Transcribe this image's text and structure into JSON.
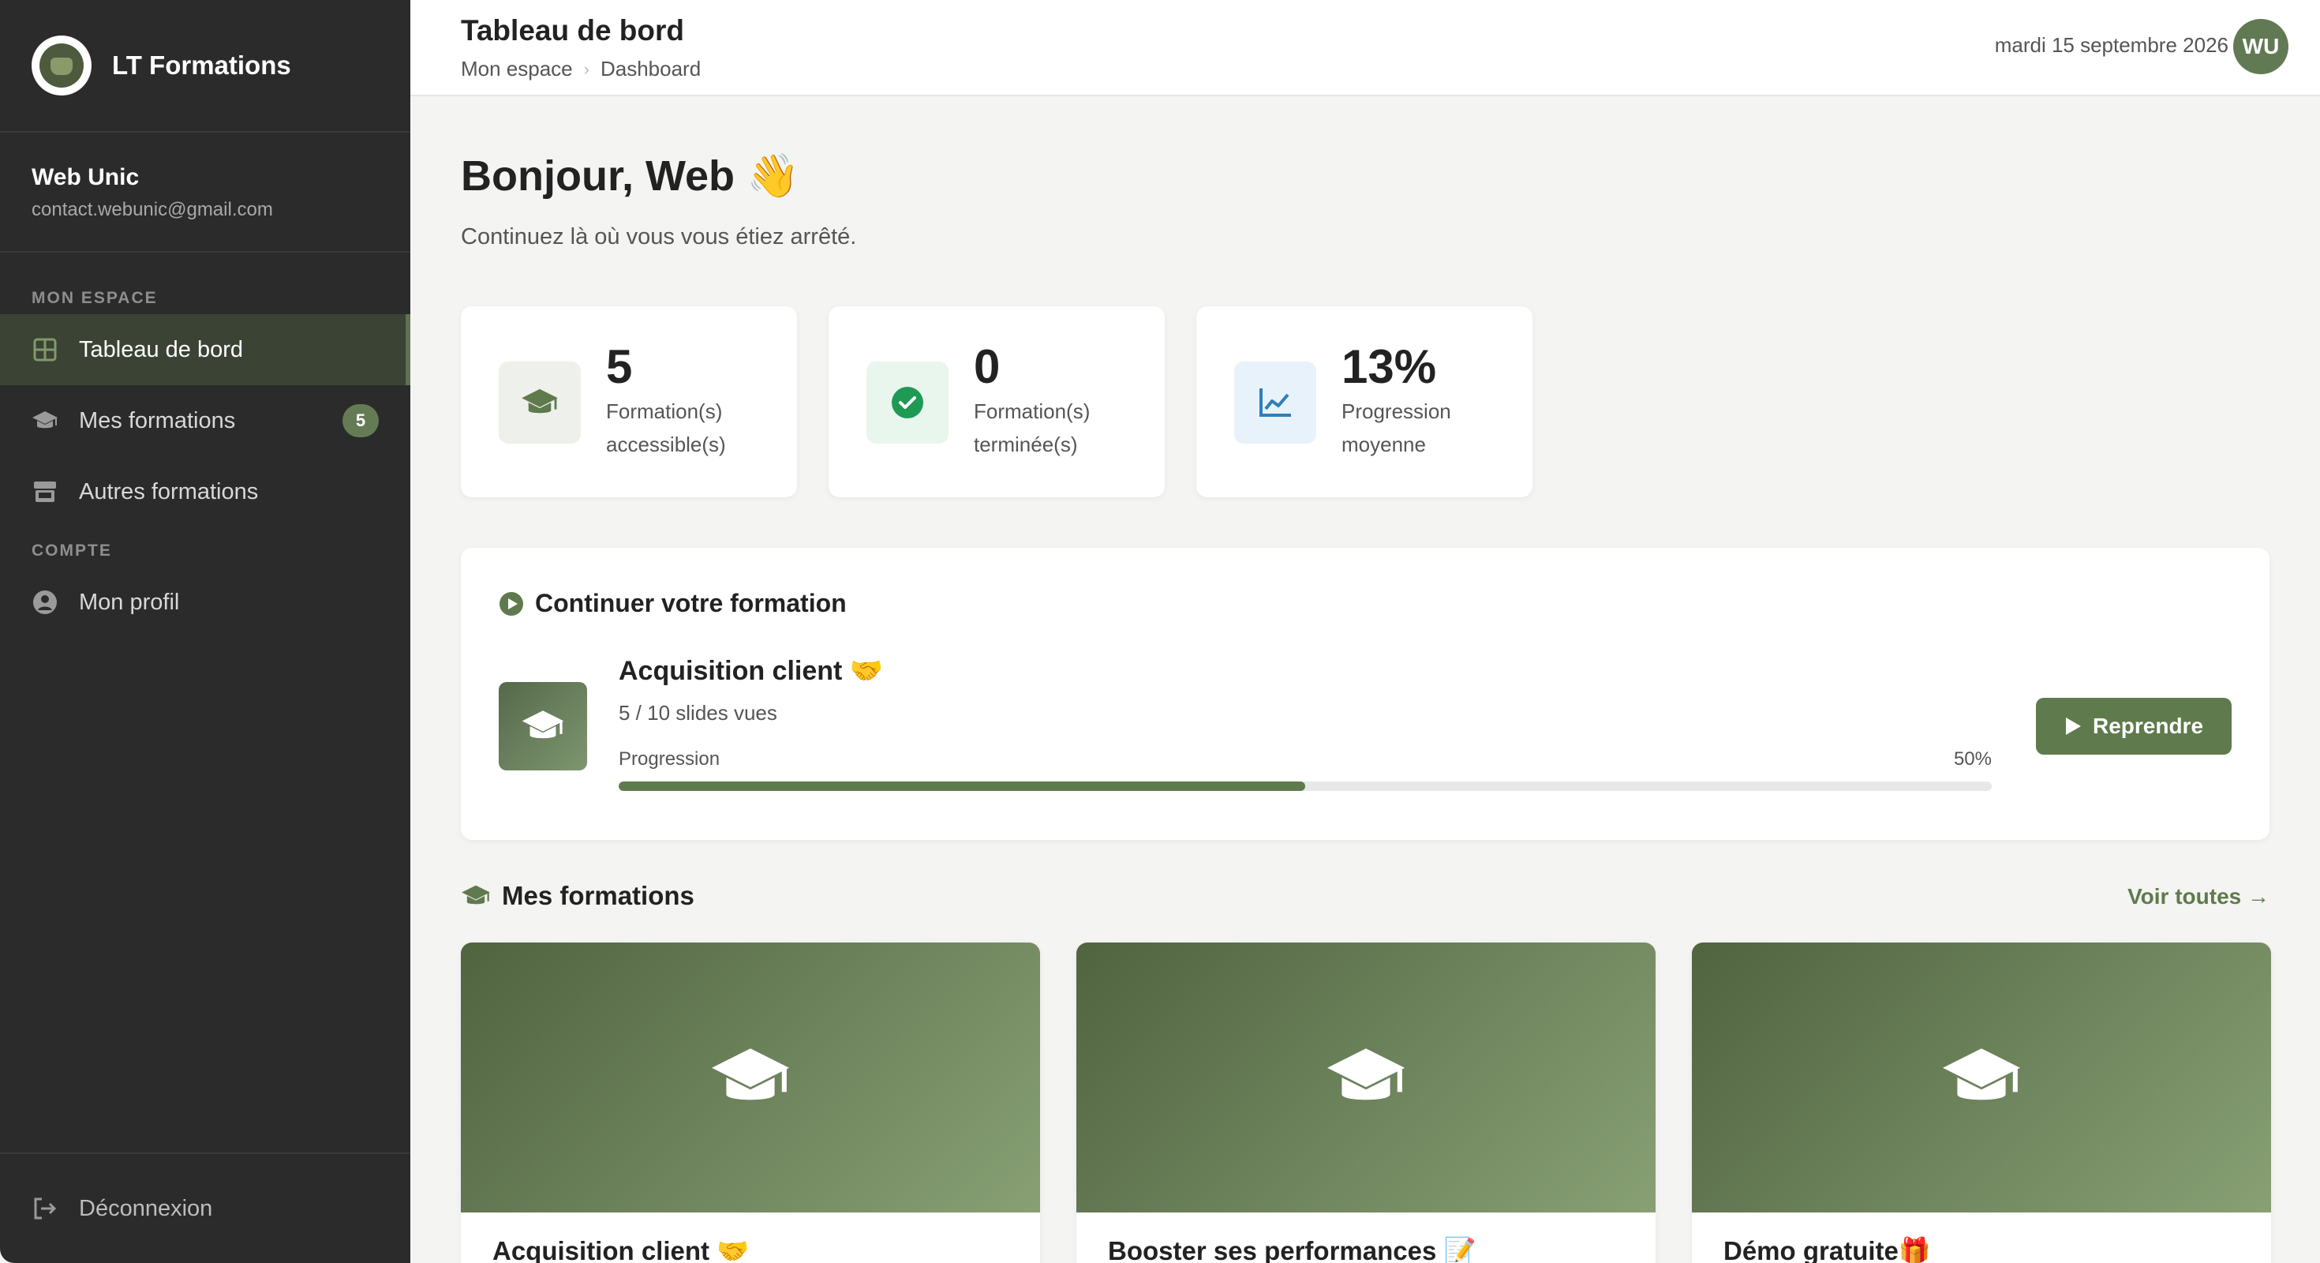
{
  "brand": {
    "name": "LT Formations"
  },
  "user": {
    "name": "Web Unic",
    "email": "contact.webunic@gmail.com",
    "initials": "WU"
  },
  "sidebar": {
    "section_main": "MON ESPACE",
    "section_account": "COMPTE",
    "items": [
      {
        "label": "Tableau de bord",
        "icon": "grid-icon",
        "active": true
      },
      {
        "label": "Mes formations",
        "icon": "graduation-cap-icon",
        "badge": "5"
      },
      {
        "label": "Autres formations",
        "icon": "store-icon"
      },
      {
        "label": "Mon profil",
        "icon": "user-circle-icon"
      }
    ],
    "logout_label": "Déconnexion"
  },
  "header": {
    "title": "Tableau de bord",
    "breadcrumb": [
      "Mon espace",
      "Dashboard"
    ],
    "date": "mardi 15 septembre 2026"
  },
  "main": {
    "greeting": "Bonjour, Web 👋",
    "subtitle": "Continuez là où vous vous étiez arrêté.",
    "stats": [
      {
        "value": "5",
        "label": "Formation(s) accessible(s)",
        "icon": "graduation-cap-icon",
        "color": "#eef0ec"
      },
      {
        "value": "0",
        "label": "Formation(s) terminée(s)",
        "icon": "check-circle-icon",
        "color": "#e9f6ee"
      },
      {
        "value": "13%",
        "label": "Progression moyenne",
        "icon": "line-chart-icon",
        "color": "#e8f2fa"
      }
    ],
    "continue": {
      "title": "Continuer votre formation",
      "course": "Acquisition client 🤝",
      "slides": "5 / 10 slides vues",
      "progress_label": "Progression",
      "progress_pct_text": "50%",
      "progress_value": 0.5,
      "resume_label": "Reprendre"
    },
    "my_courses": {
      "title": "Mes formations",
      "see_all": "Voir toutes →",
      "courses": [
        {
          "title": "Acquisition client 🤝"
        },
        {
          "title": "Booster ses performances 📝"
        },
        {
          "title": "Démo gratuite🎁"
        }
      ]
    }
  },
  "colors": {
    "accent": "#5f7a4c",
    "sidebar_bg": "#2b2b2b",
    "avatar": "#627a54"
  }
}
